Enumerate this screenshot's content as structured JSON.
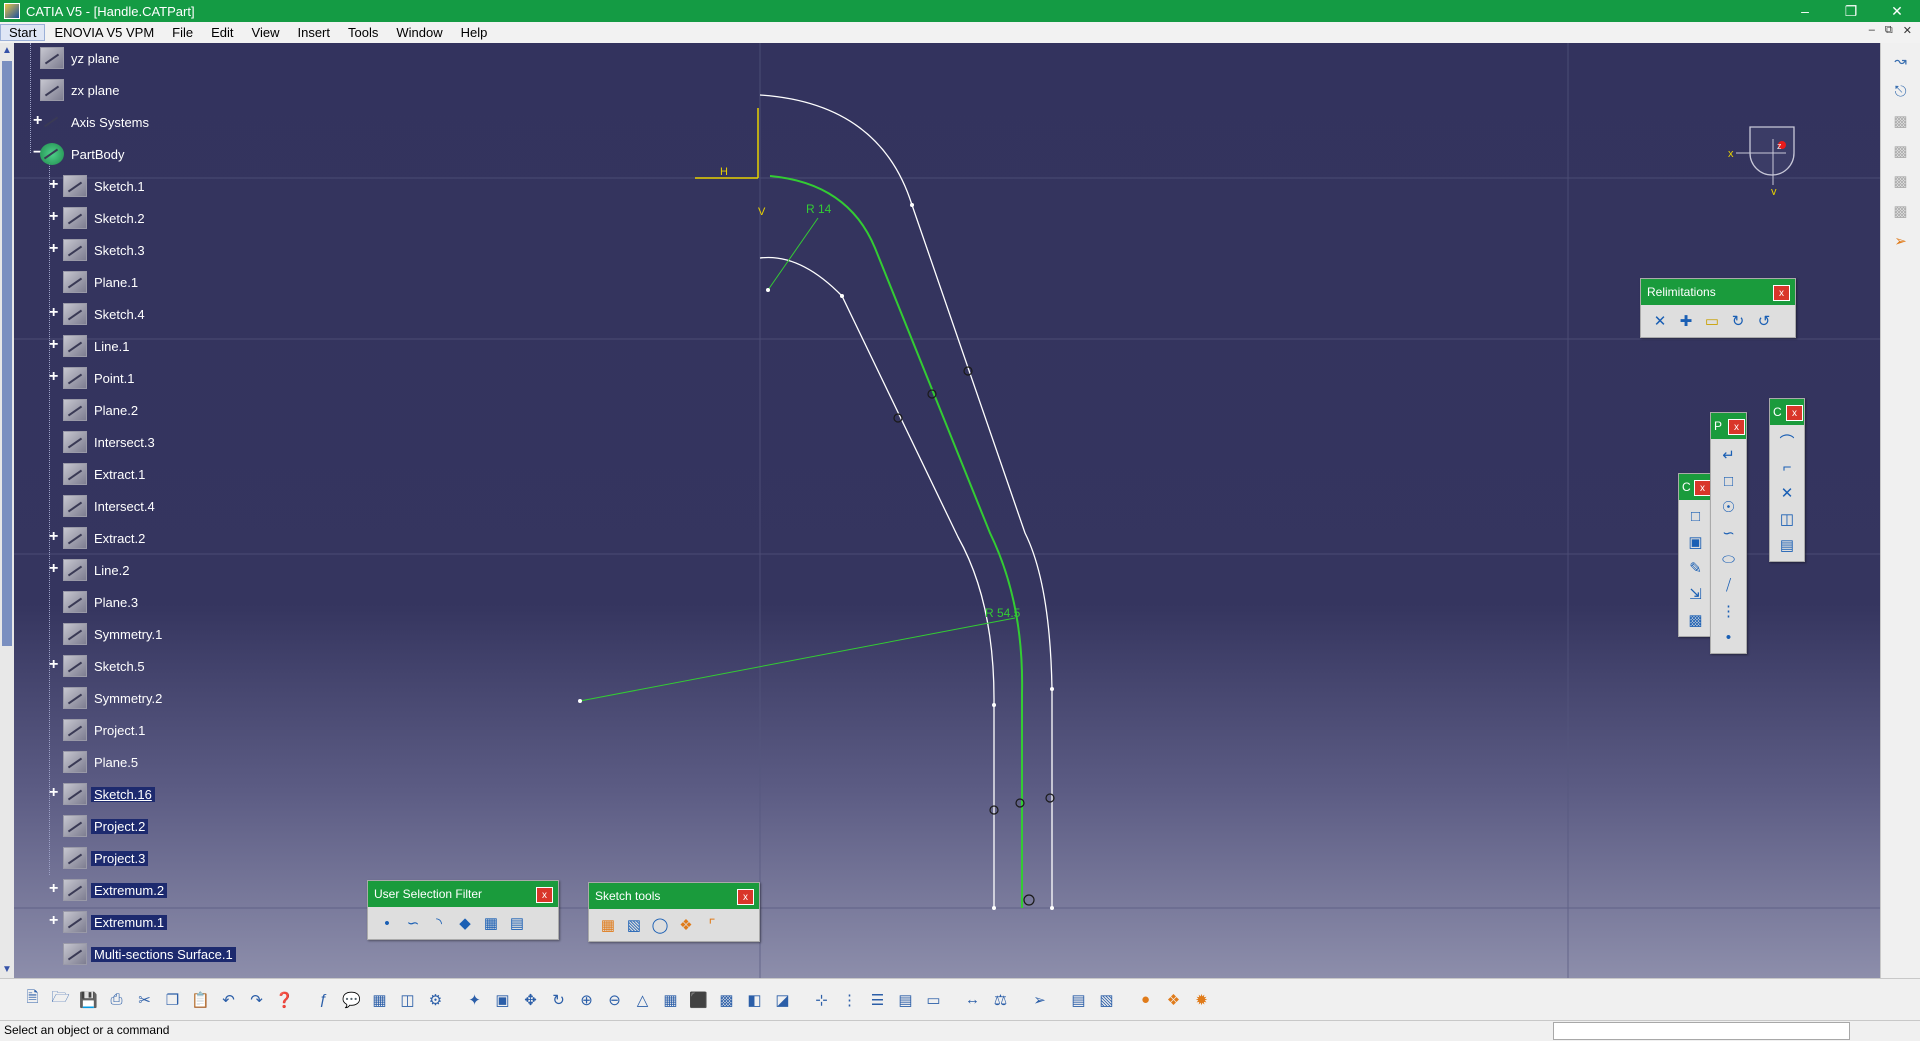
{
  "window": {
    "title": "CATIA V5 - [Handle.CATPart]",
    "controls": [
      "–",
      "❐",
      "✕"
    ]
  },
  "menu": {
    "items": [
      "Start",
      "ENOVIA V5 VPM",
      "File",
      "Edit",
      "View",
      "Insert",
      "Tools",
      "Window",
      "Help"
    ]
  },
  "tree": {
    "items": [
      {
        "label": "yz plane"
      },
      {
        "label": "zx plane"
      },
      {
        "label": "Axis Systems"
      },
      {
        "label": "PartBody"
      },
      {
        "label": "Sketch.1"
      },
      {
        "label": "Sketch.2"
      },
      {
        "label": "Sketch.3"
      },
      {
        "label": "Plane.1"
      },
      {
        "label": "Sketch.4"
      },
      {
        "label": "Line.1"
      },
      {
        "label": "Point.1"
      },
      {
        "label": "Plane.2"
      },
      {
        "label": "Intersect.3"
      },
      {
        "label": "Extract.1"
      },
      {
        "label": "Intersect.4"
      },
      {
        "label": "Extract.2"
      },
      {
        "label": "Line.2"
      },
      {
        "label": "Plane.3"
      },
      {
        "label": "Symmetry.1"
      },
      {
        "label": "Sketch.5"
      },
      {
        "label": "Symmetry.2"
      },
      {
        "label": "Project.1"
      },
      {
        "label": "Plane.5"
      },
      {
        "label": "Sketch.16"
      },
      {
        "label": "Project.2"
      },
      {
        "label": "Project.3"
      },
      {
        "label": "Extremum.2"
      },
      {
        "label": "Extremum.1"
      },
      {
        "label": "Multi-sections Surface.1"
      }
    ]
  },
  "sketch": {
    "dim_r14": "R 14",
    "dim_r545": "R 54.5",
    "axis_h": "H",
    "axis_v": "V"
  },
  "compass": {
    "x": "x",
    "y": "y",
    "z": "z"
  },
  "toolboxes": {
    "user_selection_filter": "User Selection Filter",
    "sketch_tools": "Sketch tools",
    "relimitations": "Relimitations",
    "profile_short": "P",
    "constraint_short": "C",
    "operation_short": "C",
    "close": "x"
  },
  "status": {
    "message": "Select an object or a command"
  },
  "colors": {
    "titlebar": "#149b44",
    "sketch_active": "#33cc33",
    "sketch_inactive": "#ffffff",
    "axis": "#e8d200",
    "tree_selected": "#1d2a6e"
  }
}
